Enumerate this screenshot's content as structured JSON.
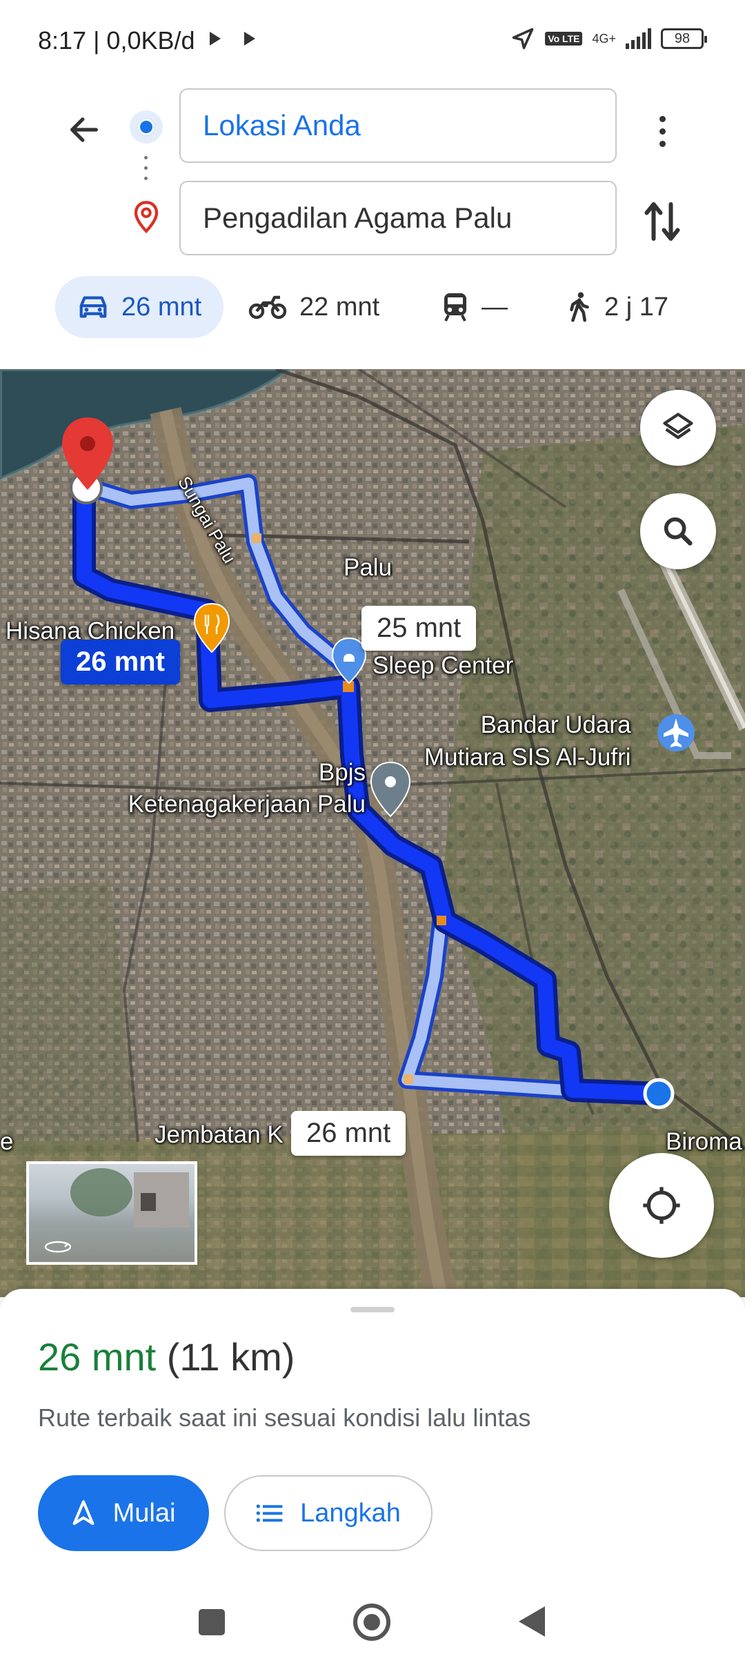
{
  "status_bar": {
    "time_data": "8:17 | 0,0KB/d",
    "network_badge": "Vo LTE",
    "network_type": "4G+",
    "battery": "98"
  },
  "directions": {
    "origin": "Lokasi Anda",
    "destination": "Pengadilan Agama Palu"
  },
  "modes": [
    {
      "icon": "car-icon",
      "label": "26 mnt",
      "active": true
    },
    {
      "icon": "motorcycle-icon",
      "label": "22 mnt",
      "active": false
    },
    {
      "icon": "transit-icon",
      "label": "—",
      "active": false
    },
    {
      "icon": "walk-icon",
      "label": "2 j 17",
      "active": false
    }
  ],
  "map": {
    "labels": {
      "city": "Palu",
      "river": "Sungai Palu",
      "restaurant": "Hisana Chicken",
      "sleep_center": "Sleep Center",
      "airport": "Bandar Udara\nMutiara SIS Al-Jufri",
      "bpjs": "Bpjs\nKetenagakerjaan Palu",
      "bridge": "Jembatan K",
      "biroma": "Biroma",
      "edge_left": "e"
    },
    "route_bubbles": {
      "primary": "26 mnt",
      "alt_1": "25 mnt",
      "alt_2": "26 mnt"
    }
  },
  "sheet": {
    "duration": "26 mnt",
    "distance": "(11 km)",
    "description": "Rute terbaik saat ini sesuai kondisi lalu lintas",
    "start_label": "Mulai",
    "steps_label": "Langkah"
  },
  "colors": {
    "accent": "#1a73e8",
    "route_primary": "#0b3fd6",
    "route_alt": "#a9c1f5",
    "duration_green": "#188038"
  }
}
